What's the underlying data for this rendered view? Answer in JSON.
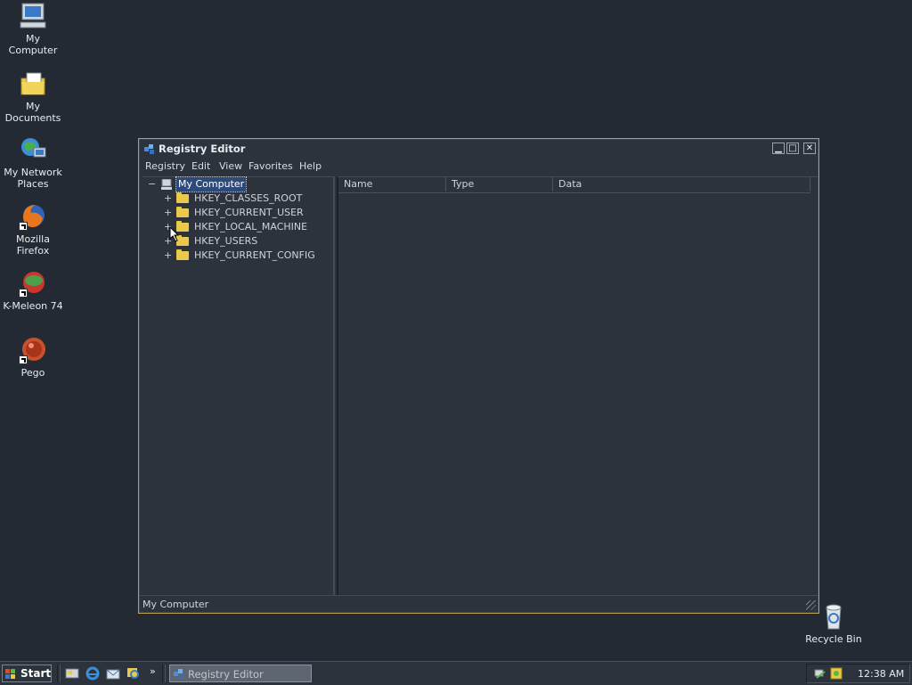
{
  "desktop": {
    "icons": [
      {
        "label": "My Computer"
      },
      {
        "label": "My Documents"
      },
      {
        "label": "My Network Places"
      },
      {
        "label": "Mozilla Firefox"
      },
      {
        "label": "K-Meleon 74"
      },
      {
        "label": "Pego"
      },
      {
        "label": "Recycle Bin"
      }
    ]
  },
  "window": {
    "title": "Registry Editor",
    "menu": [
      "Registry",
      "Edit",
      "View",
      "Favorites",
      "Help"
    ],
    "tree": {
      "root": "My Computer",
      "keys": [
        "HKEY_CLASSES_ROOT",
        "HKEY_CURRENT_USER",
        "HKEY_LOCAL_MACHINE",
        "HKEY_USERS",
        "HKEY_CURRENT_CONFIG"
      ],
      "root_expander": "−",
      "key_expander": "+"
    },
    "columns": [
      "Name",
      "Type",
      "Data"
    ],
    "status": "My Computer"
  },
  "taskbar": {
    "start_label": "Start",
    "task_label": "Registry Editor",
    "overflow_label": "»",
    "clock": "12:38 AM"
  },
  "colors": {
    "desktop_bg": "#232a33",
    "window_bg": "#2c333c",
    "window_border": "#b8a04c",
    "folder": "#e8c94a",
    "selection": "#2d4a7a"
  }
}
